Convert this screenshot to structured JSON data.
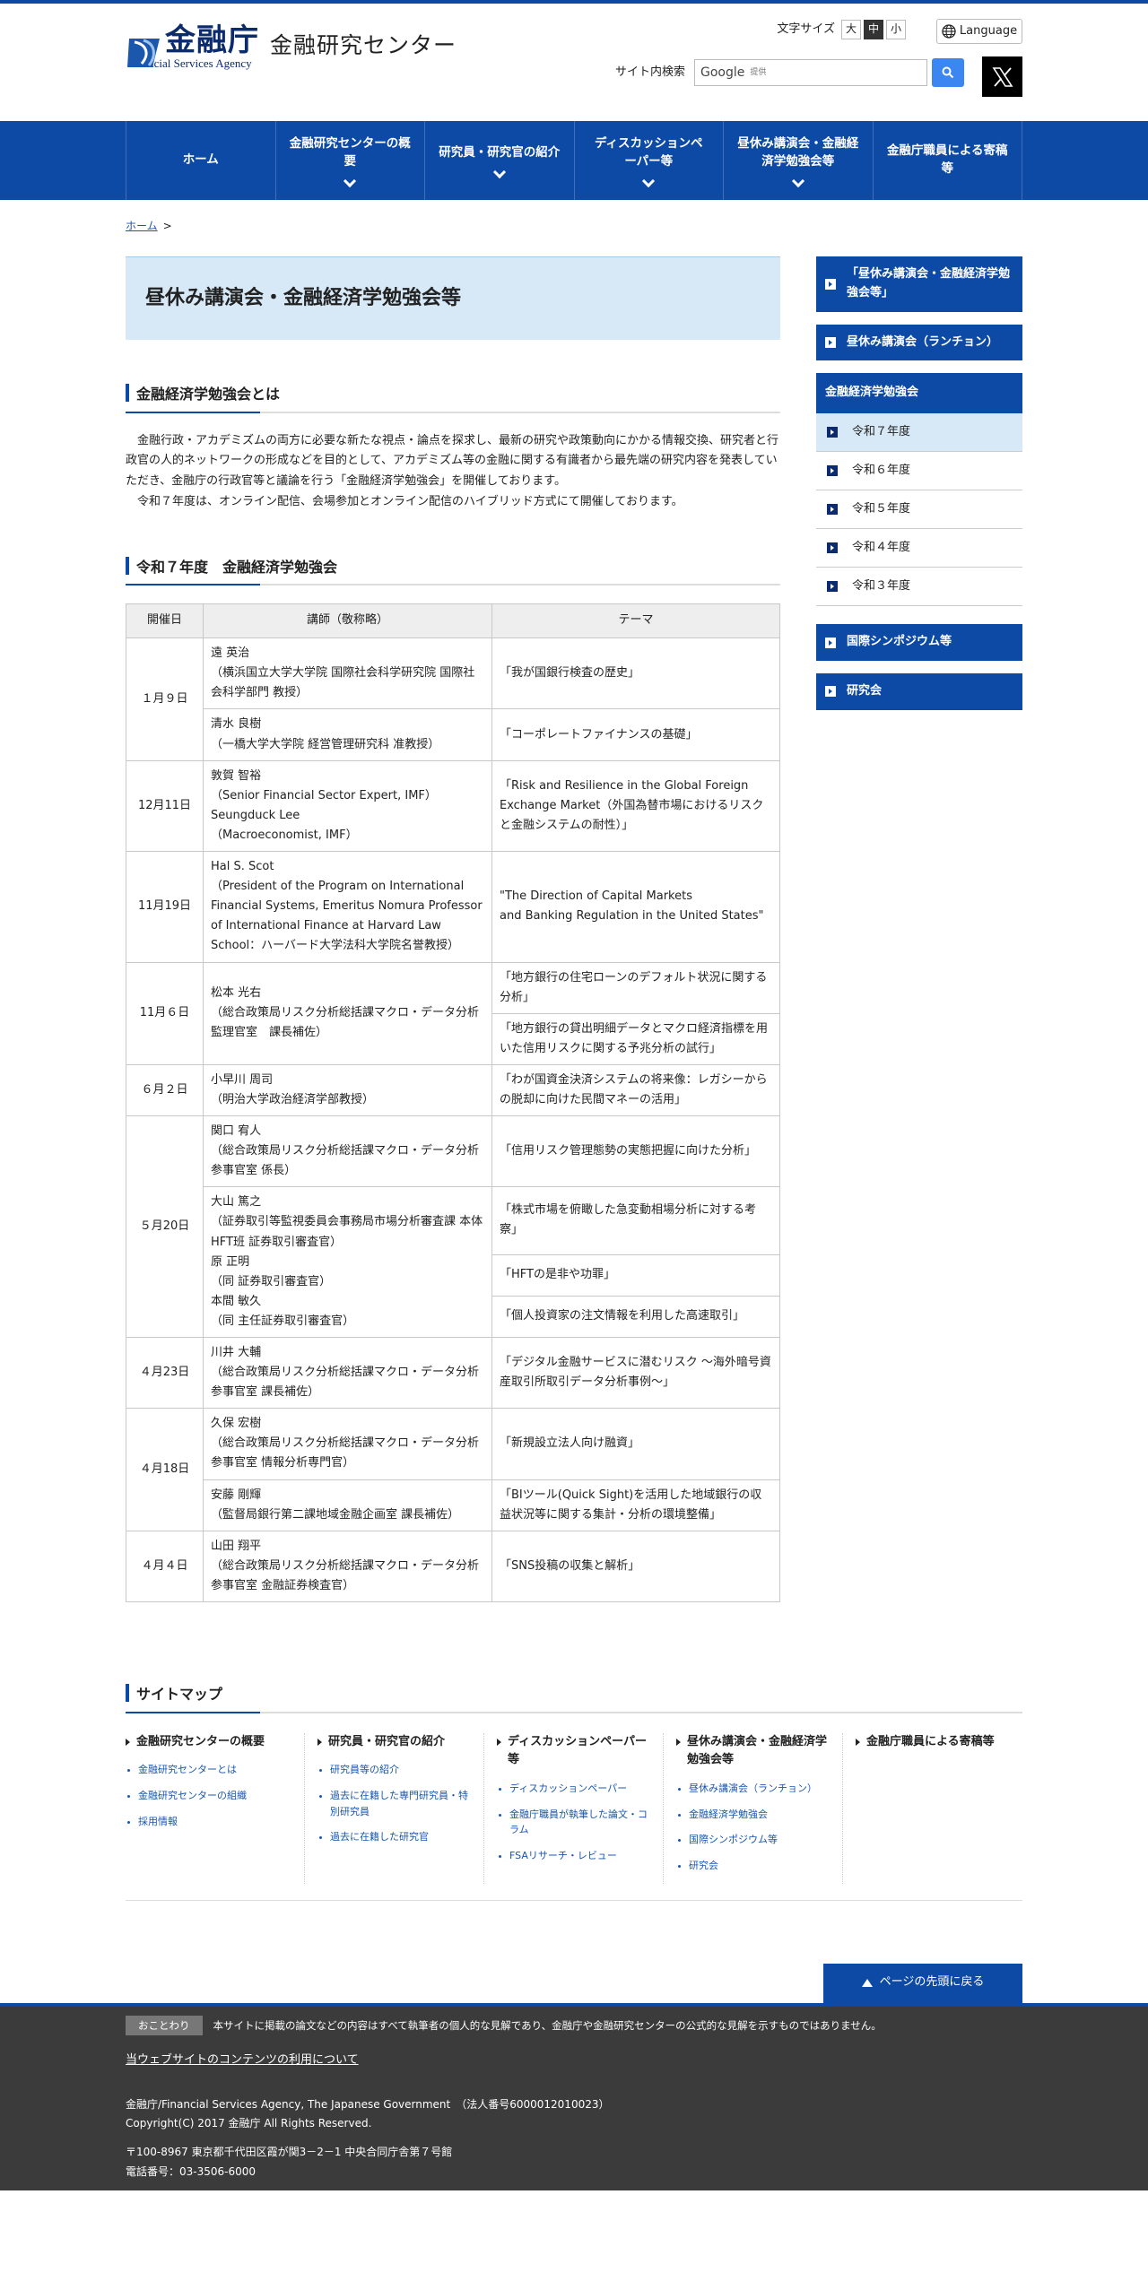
{
  "header": {
    "logo_jp": "金融庁",
    "logo_en": "Financial Services Agency",
    "site_name": "金融研究センター",
    "font_size_label": "文字サイズ",
    "font_sizes": [
      "大",
      "中",
      "小"
    ],
    "language_label": "Language",
    "search_label": "サイト内検索",
    "search_google": "Google",
    "search_provided": "提供"
  },
  "nav": [
    {
      "label": "ホーム",
      "dropdown": false
    },
    {
      "label": "金融研究センターの概要",
      "dropdown": true
    },
    {
      "label": "研究員・研究官の紹介",
      "dropdown": true
    },
    {
      "label": "ディスカッションペーパー等",
      "dropdown": true
    },
    {
      "label": "昼休み講演会・金融経済学勉強会等",
      "dropdown": true
    },
    {
      "label": "金融庁職員による寄稿等",
      "dropdown": false
    }
  ],
  "breadcrumb": {
    "home": "ホーム",
    "sep": ">"
  },
  "page_title": "昼休み講演会・金融経済学勉強会等",
  "section1": {
    "heading": "金融経済学勉強会とは",
    "para1": "金融行政・アカデミズムの両方に必要な新たな視点・論点を探求し、最新の研究や政策動向にかかる情報交換、研究者と行政官の人的ネットワークの形成などを目的として、アカデミズム等の金融に関する有識者から最先端の研究内容を発表していただき、金融庁の行政官等と議論を行う「金融経済学勉強会」を開催しております。",
    "para2": "令和７年度は、オンライン配信、会場参加とオンライン配信のハイブリッド方式にて開催しております。"
  },
  "section2": {
    "heading": "令和７年度　金融経済学勉強会",
    "columns": [
      "開催日",
      "講師（敬称略）",
      "テーマ"
    ],
    "rows": [
      {
        "date": "１月９日",
        "lecturer": "遠 英治\n（横浜国立大学大学院 国際社会科学研究院 国際社会科学部門 教授）",
        "theme": "「我が国銀行検査の歴史」"
      },
      {
        "lecturer": "清水 良樹\n（一橋大学大学院 経営管理研究科 准教授）",
        "theme": "「コーポレートファイナンスの基礎」"
      },
      {
        "date": "12月11日",
        "lecturer": "敦賀 智裕\n（Senior Financial Sector Expert, IMF）\nSeungduck Lee\n（Macroeconomist, IMF）",
        "theme": "「Risk and Resilience in the Global Foreign Exchange Market（外国為替市場におけるリスクと金融システムの耐性）」"
      },
      {
        "date": "11月19日",
        "lecturer": "Hal S. Scot\n（President of the Program on International Financial Systems, Emeritus Nomura Professor of International Finance at Harvard Law School：ハーバード大学法科大学院名誉教授）",
        "theme": "\"The Direction of Capital Markets\nand Banking Regulation in the United States\""
      },
      {
        "date": "11月６日",
        "lecturer": "松本 光右\n（総合政策局リスク分析総括課マクロ・データ分析監理官室　課長補佐）",
        "theme": "「地方銀行の住宅ローンのデフォルト状況に関する分析」"
      },
      {
        "theme": "「地方銀行の貸出明細データとマクロ経済指標を用いた信用リスクに関する予兆分析の試行」"
      },
      {
        "date": "６月２日",
        "lecturer": "小早川 周司\n（明治大学政治経済学部教授）",
        "theme": "「わが国資金決済システムの将来像：レガシーからの脱却に向けた民間マネーの活用」"
      },
      {
        "date": "５月20日",
        "lecturer": "関口 宥人\n（総合政策局リスク分析総括課マクロ・データ分析参事官室 係長）",
        "theme": "「信用リスク管理態勢の実態把握に向けた分析」"
      },
      {
        "lecturer": "大山 篤之\n（証券取引等監視委員会事務局市場分析審査課 本体HFT班 証券取引審査官）\n原 正明\n（同 証券取引審査官）\n本間 敏久\n（同 主任証券取引審査官）",
        "theme": "「株式市場を俯瞰した急変動相場分析に対する考察」"
      },
      {
        "theme": "「HFTの是非や功罪」"
      },
      {
        "theme": "「個人投資家の注文情報を利用した高速取引」"
      },
      {
        "date": "４月23日",
        "lecturer": "川井 大輔\n（総合政策局リスク分析総括課マクロ・データ分析参事官室 課長補佐）",
        "theme": "「デジタル金融サービスに潜むリスク ～海外暗号資産取引所取引データ分析事例～」"
      },
      {
        "date": "４月18日",
        "lecturer": "久保 宏樹\n（総合政策局リスク分析総括課マクロ・データ分析参事官室 情報分析専門官）",
        "theme": "「新規設立法人向け融資」"
      },
      {
        "lecturer": "安藤 剛輝\n（監督局銀行第二課地域金融企画室 課長補佐）",
        "theme": "「BIツール(Quick Sight)を活用した地域銀行の収益状況等に関する集計・分析の環境整備」"
      },
      {
        "date": "４月４日",
        "lecturer": "山田 翔平\n（総合政策局リスク分析総括課マクロ・データ分析参事官室 金融証券検査官）",
        "theme": "「SNS投稿の収集と解析」"
      }
    ]
  },
  "sidebar": {
    "box1": "「昼休み講演会・金融経済学勉強会等」",
    "box2": "昼休み講演会（ランチョン）",
    "group_head": "金融経済学勉強会",
    "years": [
      "令和７年度",
      "令和６年度",
      "令和５年度",
      "令和４年度",
      "令和３年度"
    ],
    "box3": "国際シンポジウム等",
    "box4": "研究会"
  },
  "sitemap": {
    "heading": "サイトマップ",
    "cols": [
      {
        "head": "金融研究センターの概要",
        "items": [
          "金融研究センターとは",
          "金融研究センターの組織",
          "採用情報"
        ]
      },
      {
        "head": "研究員・研究官の紹介",
        "items": [
          "研究員等の紹介",
          "過去に在籍した専門研究員・特別研究員",
          "過去に在籍した研究官"
        ]
      },
      {
        "head": "ディスカッションペーパー等",
        "items": [
          "ディスカッションペーパー",
          "金融庁職員が執筆した論文・コラム",
          "FSAリサーチ・レビュー"
        ]
      },
      {
        "head": "昼休み講演会・金融経済学勉強会等",
        "items": [
          "昼休み講演会（ランチョン）",
          "金融経済学勉強会",
          "国際シンポジウム等",
          "研究会"
        ]
      },
      {
        "head": "金融庁職員による寄稿等",
        "items": []
      }
    ]
  },
  "pagetop": "ページの先頭に戻る",
  "footer": {
    "notice_tag": "おことわり",
    "notice": "本サイトに掲載の論文などの内容はすべて執筆者の個人的な見解であり、金融庁や金融研究センターの公式的な見解を示すものではありません。",
    "terms": "当ウェブサイトのコンテンツの利用について",
    "org": "金融庁/Financial Services Agency, The Japanese Government　（法人番号6000012010023）",
    "copyright": "Copyright(C) 2017 金融庁 All Rights Reserved.",
    "address": "〒100-8967 東京都千代田区霞が関3－2－1 中央合同庁舎第７号館",
    "tel": "電話番号：03-3506-6000"
  }
}
